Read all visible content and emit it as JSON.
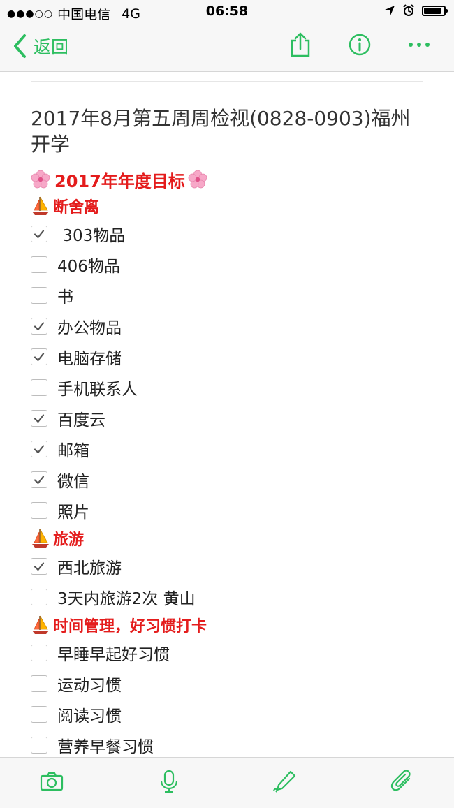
{
  "status_bar": {
    "signal": "●●●○○",
    "carrier": "中国电信",
    "network": "4G",
    "time": "06:58",
    "battery_level": 0.85
  },
  "nav": {
    "back_label": "返回",
    "icons": [
      "share-icon",
      "info-icon",
      "more-icon"
    ]
  },
  "note": {
    "title": "2017年8月第五周周检视(0828-0903)福州开学",
    "goal_heading": "2017年年度目标",
    "sections": [
      {
        "heading": "断舍离",
        "items": [
          {
            "label": " 303物品",
            "checked": true
          },
          {
            "label": "406物品",
            "checked": false
          },
          {
            "label": "书",
            "checked": false
          },
          {
            "label": "办公物品",
            "checked": true
          },
          {
            "label": "电脑存储",
            "checked": true
          },
          {
            "label": "手机联系人",
            "checked": false
          },
          {
            "label": "百度云",
            "checked": true
          },
          {
            "label": "邮箱",
            "checked": true
          },
          {
            "label": "微信",
            "checked": true
          },
          {
            "label": "照片",
            "checked": false
          }
        ]
      },
      {
        "heading": "旅游",
        "items": [
          {
            "label": "西北旅游",
            "checked": true
          },
          {
            "label": "3天内旅游2次 黄山",
            "checked": false
          }
        ]
      },
      {
        "heading": "时间管理，好习惯打卡",
        "items": [
          {
            "label": "早睡早起好习惯",
            "checked": false
          },
          {
            "label": "运动习惯",
            "checked": false
          },
          {
            "label": "阅读习惯",
            "checked": false
          },
          {
            "label": "营养早餐习惯",
            "checked": false
          }
        ]
      }
    ]
  },
  "toolbar": {
    "icons": [
      "camera-icon",
      "microphone-icon",
      "pen-icon",
      "paperclip-icon"
    ]
  },
  "colors": {
    "accent": "#2dbe60",
    "heading_red": "#e41c1c",
    "checkbox_border": "#bdbdbd",
    "check_mark": "#555555"
  }
}
